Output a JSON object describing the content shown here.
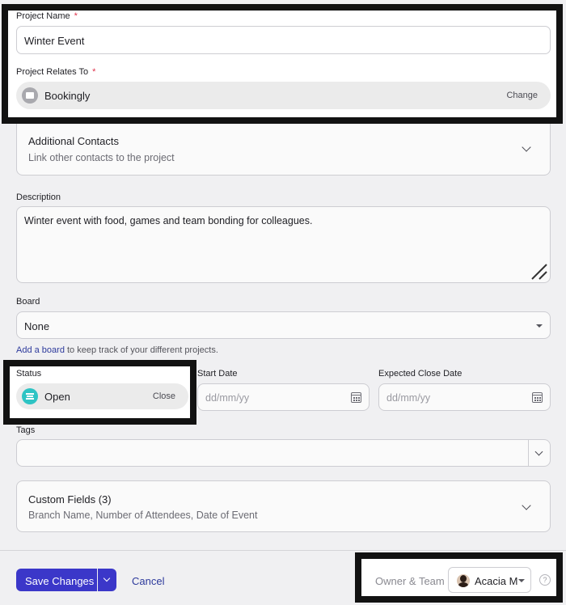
{
  "project_name": {
    "label": "Project Name",
    "required_mark": "*",
    "value": "Winter Event"
  },
  "relates_to": {
    "label": "Project Relates To",
    "required_mark": "*",
    "value": "Bookingly",
    "change_label": "Change"
  },
  "additional_contacts": {
    "title": "Additional Contacts",
    "subtitle": "Link other contacts to the project"
  },
  "description": {
    "label": "Description",
    "value": "Winter event with food, games and team bonding for colleagues."
  },
  "board": {
    "label": "Board",
    "value": "None",
    "add_link": "Add a board",
    "help_text": " to keep track of your different projects."
  },
  "status": {
    "label": "Status",
    "value": "Open",
    "close_label": "Close",
    "accent": "#2ec4c4"
  },
  "start_date": {
    "label": "Start Date",
    "placeholder": "dd/mm/yy"
  },
  "expected_close_date": {
    "label": "Expected Close Date",
    "placeholder": "dd/mm/yy"
  },
  "tags": {
    "label": "Tags"
  },
  "custom_fields": {
    "title": "Custom Fields (3)",
    "subtitle": "Branch Name, Number of Attendees, Date of Event"
  },
  "footer": {
    "save_label": "Save Changes",
    "cancel_label": "Cancel",
    "owner_team_label": "Owner & Team",
    "owner_name": "Acacia M",
    "help_icon": "?"
  },
  "colors": {
    "primary": "#3b37c9",
    "highlight_border": "#121212"
  }
}
